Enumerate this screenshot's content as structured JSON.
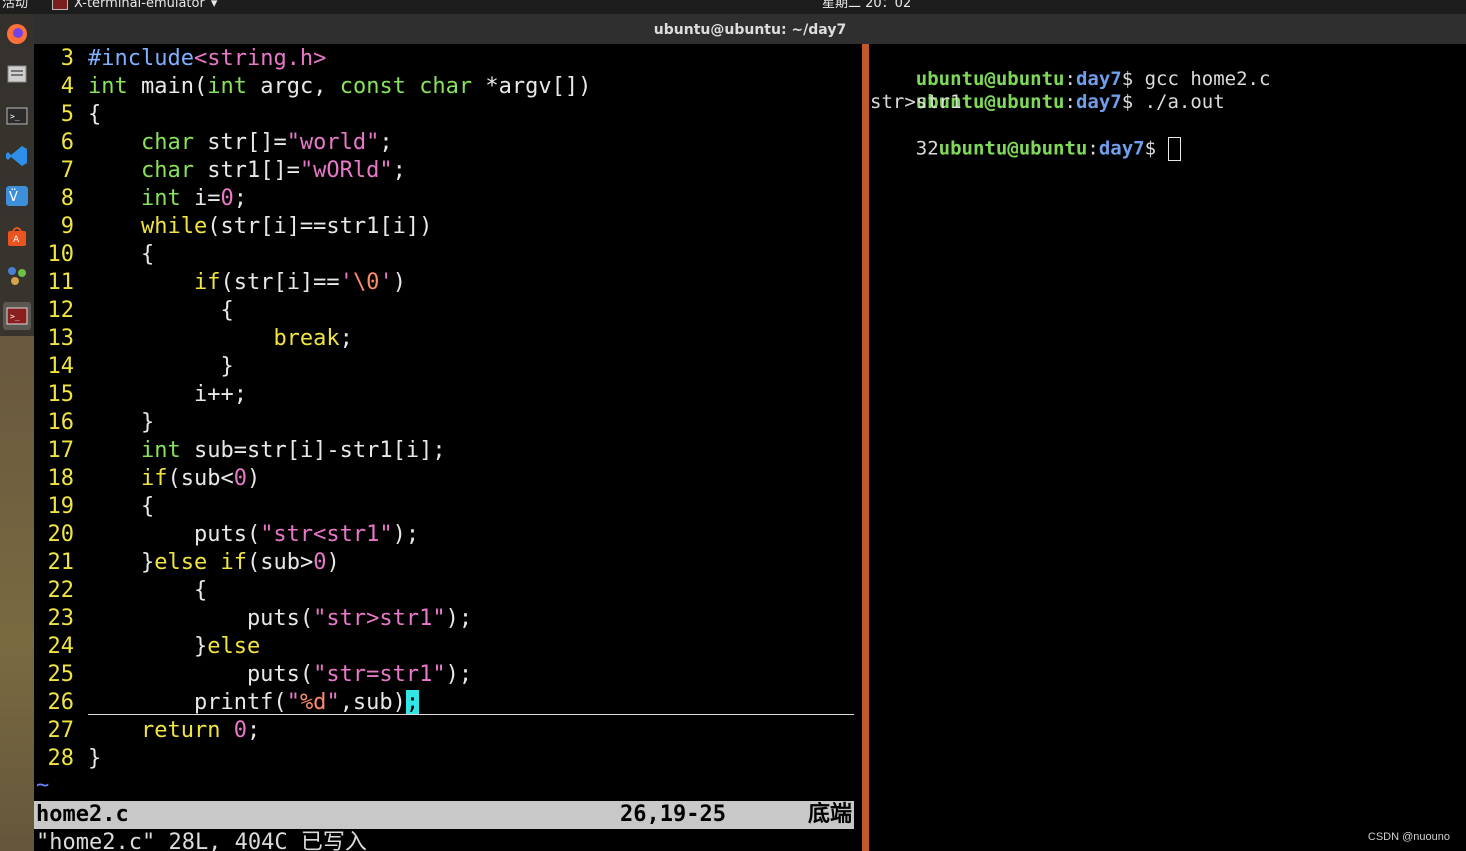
{
  "topbar": {
    "activities": "活动",
    "app_name": "X-terminal-emulator",
    "clock": "星期二 20：02"
  },
  "window": {
    "title": "ubuntu@ubuntu: ~/day7"
  },
  "dock": {
    "items": [
      {
        "name": "firefox-icon",
        "color": "#ff7139"
      },
      {
        "name": "files-icon",
        "color": "#c9c9c9"
      },
      {
        "name": "terminal-icon",
        "color": "#2b2b2b"
      },
      {
        "name": "vscode-icon",
        "color": "#2f8fe8"
      },
      {
        "name": "vmware-icon",
        "color": "#3c8fd8"
      },
      {
        "name": "software-store-icon",
        "color": "#e95420"
      },
      {
        "name": "network-tool-icon",
        "color": "#4a7fd6"
      },
      {
        "name": "x-terminal-icon",
        "color": "#8b1e1e"
      }
    ]
  },
  "editor": {
    "lines": [
      {
        "n": "3",
        "t": "#include<string.h>"
      },
      {
        "n": "4",
        "t": "int main(int argc, const char *argv[])"
      },
      {
        "n": "5",
        "t": "{"
      },
      {
        "n": "6",
        "t": "    char str[]=\"world\";"
      },
      {
        "n": "7",
        "t": "    char str1[]=\"wORld\";"
      },
      {
        "n": "8",
        "t": "    int i=0;"
      },
      {
        "n": "9",
        "t": "    while(str[i]==str1[i])"
      },
      {
        "n": "10",
        "t": "    {"
      },
      {
        "n": "11",
        "t": "        if(str[i]=='\\0')"
      },
      {
        "n": "12",
        "t": "          {"
      },
      {
        "n": "13",
        "t": "              break;"
      },
      {
        "n": "14",
        "t": "          }"
      },
      {
        "n": "15",
        "t": "        i++;"
      },
      {
        "n": "16",
        "t": "    }"
      },
      {
        "n": "17",
        "t": "    int sub=str[i]-str1[i];"
      },
      {
        "n": "18",
        "t": "    if(sub<0)"
      },
      {
        "n": "19",
        "t": "    {"
      },
      {
        "n": "20",
        "t": "        puts(\"str<str1\");"
      },
      {
        "n": "21",
        "t": "    }else if(sub>0)"
      },
      {
        "n": "22",
        "t": "        {"
      },
      {
        "n": "23",
        "t": "            puts(\"str>str1\");"
      },
      {
        "n": "24",
        "t": "        }else"
      },
      {
        "n": "25",
        "t": "            puts(\"str=str1\");"
      },
      {
        "n": "26",
        "t": "        printf(\"%d\",sub);"
      },
      {
        "n": "27",
        "t": "    return 0;"
      },
      {
        "n": "28",
        "t": "}"
      }
    ],
    "tilde": "~",
    "status": {
      "filename": "home2.c",
      "position": "26,19-25",
      "where": "底端"
    },
    "cmdline": "\"home2.c\" 28L, 404C 已写入"
  },
  "terminal": {
    "user": "ubuntu@ubuntu",
    "sep": ":",
    "dir": "day7",
    "dollar": "$",
    "cmd1": " gcc home2.c",
    "cmd2": " ./a.out",
    "out1": "str>str1",
    "out2": "32"
  },
  "watermark": "CSDN @nuouno"
}
